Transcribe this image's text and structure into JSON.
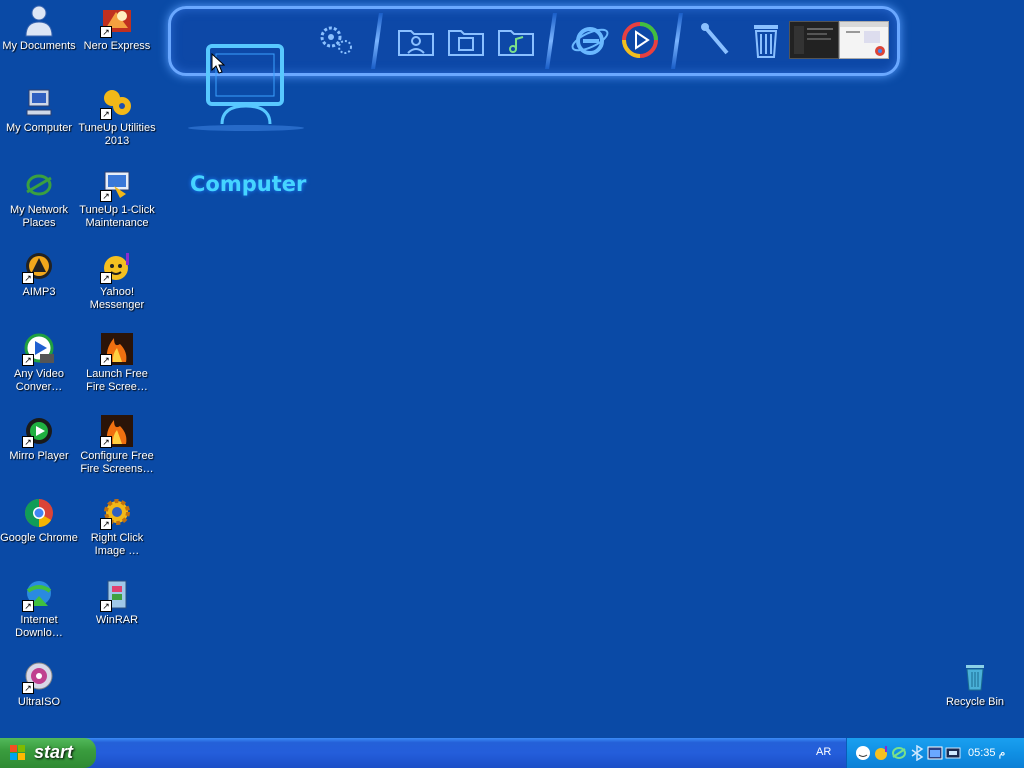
{
  "desktop": {
    "icons": [
      {
        "label": "My Documents",
        "icon": "my-documents-icon"
      },
      {
        "label": "Nero Express",
        "icon": "nero-express-icon"
      },
      {
        "label": "My Computer",
        "icon": "my-computer-icon"
      },
      {
        "label": "TuneUp Utilities 2013",
        "icon": "tuneup-utilities-icon"
      },
      {
        "label": "My Network Places",
        "icon": "network-places-icon"
      },
      {
        "label": "TuneUp 1-Click Maintenance",
        "icon": "tuneup-maintenance-icon"
      },
      {
        "label": "AIMP3",
        "icon": "aimp3-icon"
      },
      {
        "label": "Yahoo! Messenger",
        "icon": "yahoo-messenger-icon"
      },
      {
        "label": "Any Video Conver…",
        "icon": "any-video-converter-icon"
      },
      {
        "label": "Launch Free Fire Scree…",
        "icon": "free-fire-launch-icon"
      },
      {
        "label": "Mirro Player",
        "icon": "mirro-player-icon"
      },
      {
        "label": "Configure Free Fire Screens…",
        "icon": "free-fire-configure-icon"
      },
      {
        "label": "Google Chrome",
        "icon": "google-chrome-icon"
      },
      {
        "label": "Right Click Image …",
        "icon": "right-click-image-icon"
      },
      {
        "label": "Internet Downlo…",
        "icon": "internet-download-manager-icon"
      },
      {
        "label": "WinRAR",
        "icon": "winrar-icon"
      },
      {
        "label": "UltraISO",
        "icon": "ultraiso-icon"
      }
    ],
    "recycle_bin": {
      "label": "Recycle Bin",
      "icon": "recycle-bin-icon"
    }
  },
  "dock": {
    "title": "Computer",
    "items": [
      "settings-gears-icon",
      "user-folder-icon",
      "folder-icon",
      "music-folder-icon",
      "internet-explorer-icon",
      "media-player-icon",
      "tools-icon",
      "trash-icon",
      "window-preview-dark",
      "window-preview-chrome"
    ]
  },
  "taskbar": {
    "start_label": "start",
    "language": "AR",
    "clock": "05:35 م"
  },
  "colors": {
    "desktop": "#0a4aa6",
    "dock_glow": "#6aa8ff",
    "title": "#45d4ff",
    "start_green": "#3a9d3e",
    "tray": "#1090e4"
  }
}
